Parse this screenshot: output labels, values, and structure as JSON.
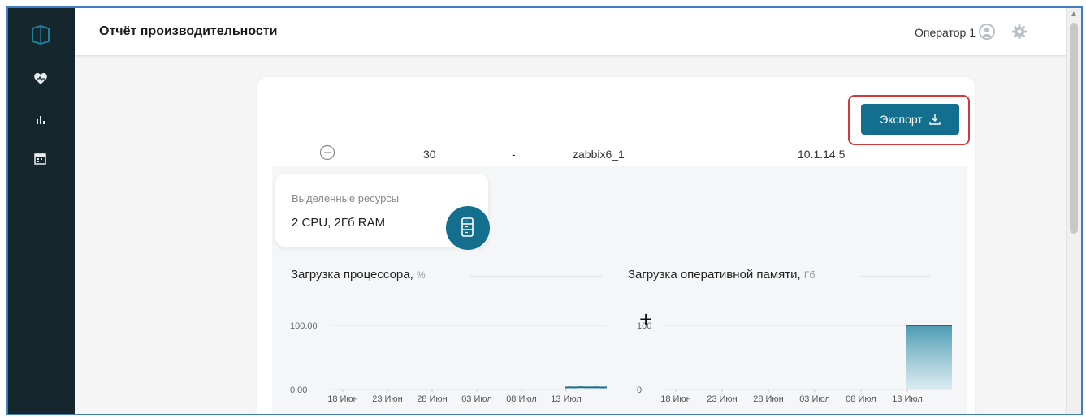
{
  "app": {
    "page_title": "Отчёт производительности"
  },
  "header": {
    "user_name": "Оператор 1"
  },
  "sidebar": {
    "items": [
      {
        "name": "health",
        "icon": "heart-pulse-icon"
      },
      {
        "name": "charts",
        "icon": "bar-chart-icon"
      },
      {
        "name": "calendar",
        "icon": "calendar-icon"
      }
    ]
  },
  "toolbar": {
    "export_label": "Экспорт",
    "export_icon": "download-icon"
  },
  "row": {
    "number": "30",
    "dash": "-",
    "host": "zabbix6_1",
    "ip": "10.1.14.5"
  },
  "resources": {
    "label": "Выделенные ресурсы",
    "value": "2 CPU, 2Гб RAM"
  },
  "colors": {
    "accent": "#146f8e",
    "highlight": "#d23a3a",
    "sidebar": "#16262d"
  },
  "chart_data": [
    {
      "type": "line",
      "title": "Загрузка процессора,",
      "unit": "%",
      "x_ticks": [
        "18 Июн",
        "23 Июн",
        "28 Июн",
        "03 Июл",
        "08 Июл",
        "13 Июл"
      ],
      "y_ticks": [
        "100.00",
        "0.00"
      ],
      "ylim": [
        0,
        100
      ],
      "series": [
        {
          "x_start": "13 Июл",
          "values": [
            3,
            3.5,
            3.2,
            3.6,
            3.3,
            3.4,
            3.5,
            3.2,
            3.3
          ]
        }
      ]
    },
    {
      "type": "area",
      "title": "Загрузка оперативной памяти,",
      "unit": "Гб",
      "x_ticks": [
        "18 Июн",
        "23 Июн",
        "28 Июн",
        "03 Июл",
        "08 Июл",
        "13 Июл"
      ],
      "y_ticks": [
        "100",
        "0"
      ],
      "ylim": [
        0,
        100
      ],
      "series": [
        {
          "x_start": "13 Июл",
          "values": [
            100,
            100
          ]
        }
      ]
    }
  ]
}
